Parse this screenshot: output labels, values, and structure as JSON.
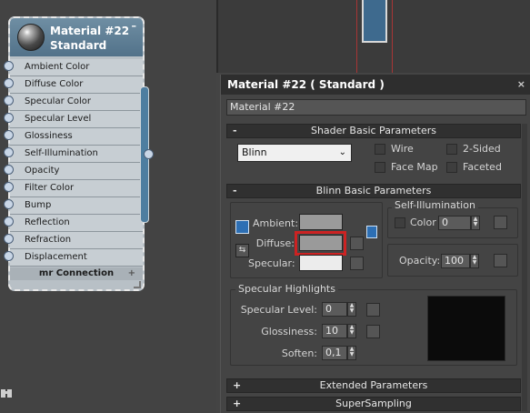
{
  "node": {
    "title": "Material #22",
    "subtitle": "Standard",
    "minimize": "–",
    "slots": [
      "Ambient Color",
      "Diffuse Color",
      "Specular Color",
      "Specular Level",
      "Glossiness",
      "Self-Illumination",
      "Opacity",
      "Filter Color",
      "Bump",
      "Reflection",
      "Refraction",
      "Displacement"
    ],
    "footer": "mr Connection",
    "footer_plus": "+"
  },
  "panel": {
    "title": "Material #22  ( Standard )",
    "close": "×",
    "name_value": "Material #22"
  },
  "shader": {
    "rollout": "Shader Basic Parameters",
    "toggle": "-",
    "dropdown_value": "Blinn",
    "wire": "Wire",
    "two_sided": "2-Sided",
    "face_map": "Face Map",
    "faceted": "Faceted"
  },
  "blinn": {
    "rollout": "Blinn Basic Parameters",
    "toggle": "-",
    "ambient": "Ambient:",
    "diffuse": "Diffuse:",
    "specular": "Specular:",
    "self_illum_group": "Self-Illumination",
    "color": "Color",
    "color_value": "0",
    "opacity": "Opacity:",
    "opacity_value": "100",
    "colors": {
      "ambient": "#9a9a9a",
      "diffuse": "#9a9a9a",
      "specular": "#ececec",
      "highlight": "#cc2222"
    }
  },
  "spec": {
    "group": "Specular Highlights",
    "level": "Specular Level:",
    "level_value": "0",
    "gloss": "Glossiness:",
    "gloss_value": "10",
    "soften": "Soften:",
    "soften_value": "0,1"
  },
  "rollouts": {
    "extended": "Extended Parameters",
    "supersampling": "SuperSampling",
    "plus": "+"
  }
}
